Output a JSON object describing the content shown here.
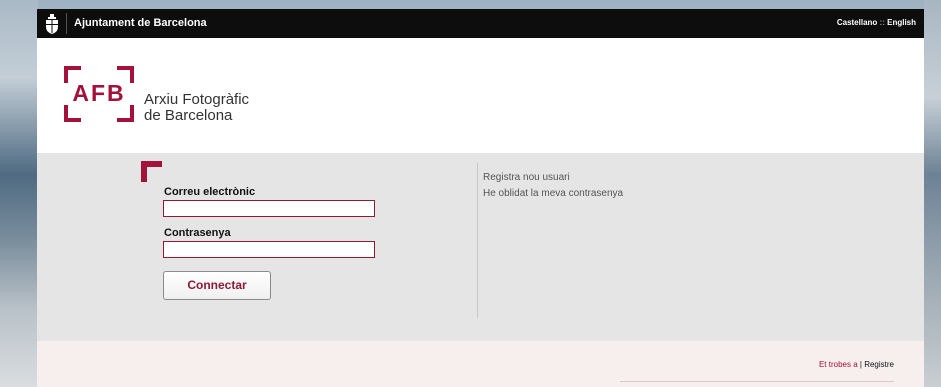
{
  "topbar": {
    "city": "Ajuntament de Barcelona",
    "lang_castellano": "Castellano",
    "lang_divider": "::",
    "lang_english": "English",
    "crest_icon": "barcelona-crest-icon"
  },
  "header": {
    "logo_text": "AFB",
    "org_name_line1": "Arxiu Fotogràfic",
    "org_name_line2": "de Barcelona"
  },
  "login": {
    "email_label": "Correu electrònic",
    "email_value": "",
    "password_label": "Contrasenya",
    "password_value": "",
    "submit_label": "Connectar"
  },
  "side_links": {
    "register": "Registra nou usuari",
    "forgot": "He oblidat la meva contrasenya"
  },
  "footer": {
    "find_us": "Et trobes a",
    "divider": "|",
    "current": "Registre"
  },
  "colors": {
    "brand": "#a3123a",
    "topbar": "#0d0d0d",
    "panel": "#e5e5e5"
  }
}
